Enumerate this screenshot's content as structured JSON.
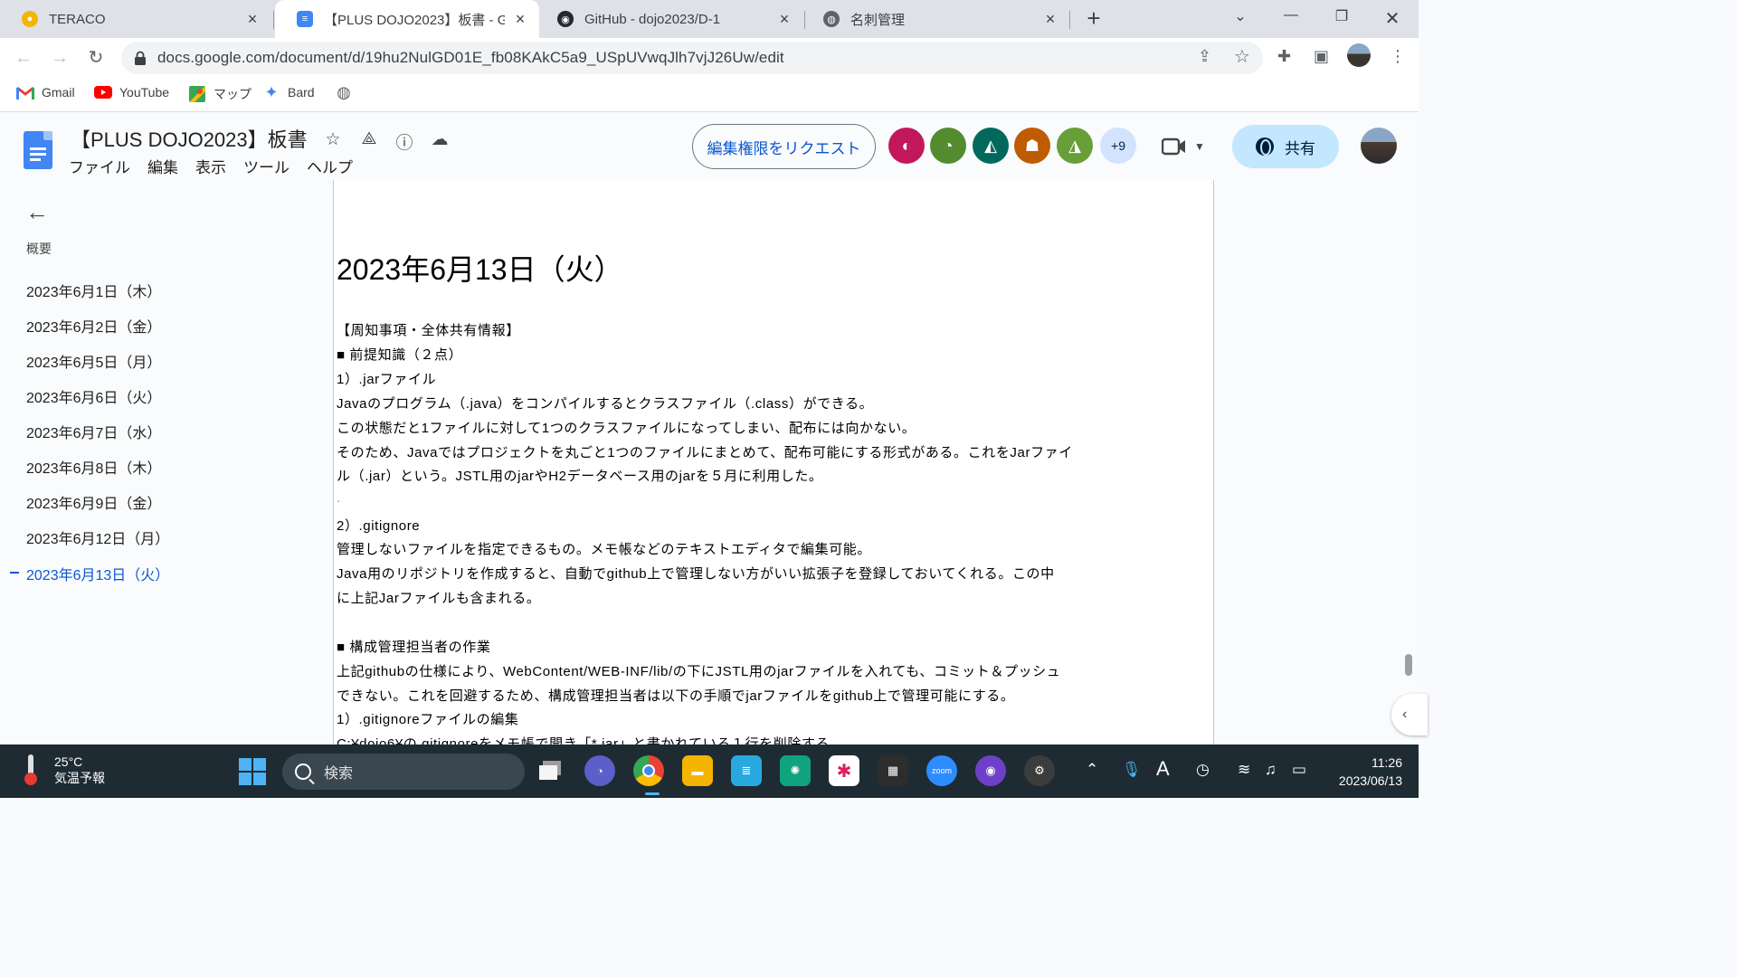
{
  "browser": {
    "tabs": [
      {
        "title": "TERACO",
        "favicon": "teraco-icon",
        "color": "#f4b400"
      },
      {
        "title": "【PLUS DOJO2023】板書 - Google",
        "favicon": "docs-icon",
        "color": "#4285f4"
      },
      {
        "title": "GitHub - dojo2023/D-1",
        "favicon": "github-icon",
        "color": "#24292f"
      },
      {
        "title": "名刺管理",
        "favicon": "globe-icon",
        "color": "#5f6368"
      }
    ],
    "url": "docs.google.com/document/d/19hu2NulGD01E_fb08KAkC5a9_USpUVwqJlh7vjJ26Uw/edit",
    "bookmarks": [
      {
        "label": "Gmail",
        "icon": "gmail-icon"
      },
      {
        "label": "YouTube",
        "icon": "youtube-icon"
      },
      {
        "label": "マップ",
        "icon": "maps-icon"
      },
      {
        "label": "Bard",
        "icon": "bard-icon"
      }
    ]
  },
  "docs": {
    "title": "【PLUS DOJO2023】板書",
    "menu": [
      "ファイル",
      "編集",
      "表示",
      "ツール",
      "ヘルプ"
    ],
    "request_edit": "編集権限をリクエスト",
    "collaborators": [
      {
        "icon": "dolphin-avatar-icon",
        "color": "#c2185b"
      },
      {
        "icon": "capybara-avatar-icon",
        "color": "#558b2f"
      },
      {
        "icon": "bird-avatar-icon",
        "color": "#00695c"
      },
      {
        "icon": "ghost-avatar-icon",
        "color": "#bf5b00"
      },
      {
        "icon": "squirrel-avatar-icon",
        "color": "#689f38"
      }
    ],
    "more_collaborators": "+9",
    "share": "共有",
    "accent": "#0b57d0"
  },
  "outline": {
    "label": "概要",
    "items": [
      "2023年6月1日（木）",
      "2023年6月2日（金）",
      "2023年6月5日（月）",
      "2023年6月6日（火）",
      "2023年6月7日（水）",
      "2023年6月8日（木）",
      "2023年6月9日（金）",
      "2023年6月12日（月）",
      "2023年6月13日（火）"
    ],
    "active_index": 8
  },
  "document": {
    "heading": "2023年6月13日（火）",
    "lines": [
      "【周知事項・全体共有情報】",
      "■ 前提知識（２点）",
      "1）.jarファイル",
      "Javaのプログラム（.java）をコンパイルするとクラスファイル（.class）ができる。",
      "この状態だと1ファイルに対して1つのクラスファイルになってしまい、配布には向かない。",
      "そのため、Javaではプロジェクトを丸ごと1つのファイルにまとめて、配布可能にする形式がある。これをJarファイ",
      "ル（.jar）という。JSTL用のjarやH2データベース用のjarを５月に利用した。",
      ".",
      "2）.gitignore",
      "管理しないファイルを指定できるもの。メモ帳などのテキストエディタで編集可能。",
      "Java用のリポジトリを作成すると、自動でgithub上で管理しない方がいい拡張子を登録しておいてくれる。この中",
      "に上記Jarファイルも含まれる。",
      "",
      "■ 構成管理担当者の作業",
      "上記githubの仕様により、WebContent/WEB-INF/lib/の下にJSTL用のjarファイルを入れても、コミット＆プッシュ",
      "できない。これを回避するため、構成管理担当者は以下の手順でjarファイルをgithub上で管理可能にする。",
      "1）.gitignoreファイルの編集",
      "C:¥dojo6¥の.gitignoreをメモ帳で開き「*.jar」と書かれている１行を削除する。"
    ]
  },
  "taskbar": {
    "temperature": "25°C",
    "weather": "気温予報",
    "search_placeholder": "検索",
    "time": "11:26",
    "date": "2023/06/13",
    "apps": [
      "task-view-icon",
      "meet-icon",
      "chrome-icon",
      "file-explorer-icon",
      "notepad-icon",
      "chatgpt-icon",
      "slack-icon",
      "terminal-icon",
      "zoom-icon",
      "github-desktop-icon",
      "settings-icon"
    ]
  }
}
